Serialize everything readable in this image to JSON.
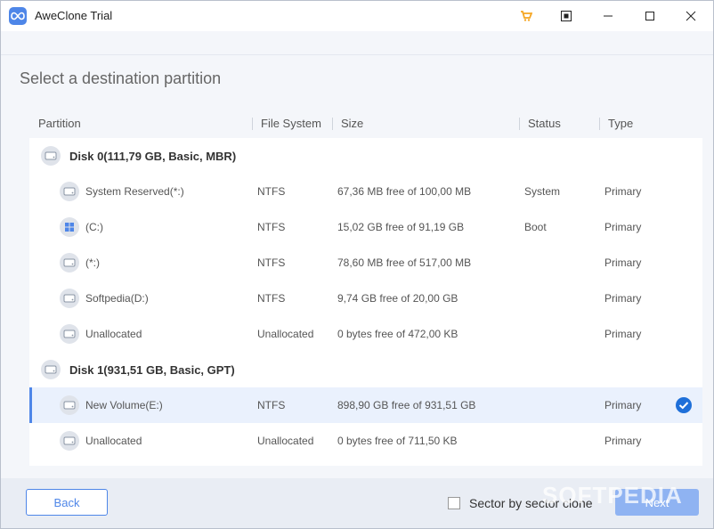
{
  "window": {
    "title": "AweClone Trial"
  },
  "heading": "Select a destination partition",
  "columns": {
    "partition": "Partition",
    "file_system": "File System",
    "size": "Size",
    "status": "Status",
    "type": "Type"
  },
  "rows": [
    {
      "kind": "disk",
      "name": "Disk 0(111,79 GB, Basic, MBR)"
    },
    {
      "kind": "partition",
      "icon": "drive-icon",
      "name": "System Reserved(*:)",
      "fs": "NTFS",
      "size": "67,36 MB free of 100,00 MB",
      "status": "System",
      "type": "Primary"
    },
    {
      "kind": "partition",
      "icon": "windows-drive-icon",
      "name": "(C:)",
      "fs": "NTFS",
      "size": "15,02 GB free of 91,19 GB",
      "status": "Boot",
      "type": "Primary"
    },
    {
      "kind": "partition",
      "icon": "drive-icon",
      "name": "(*:)",
      "fs": "NTFS",
      "size": "78,60 MB free of 517,00 MB",
      "status": "",
      "type": "Primary"
    },
    {
      "kind": "partition",
      "icon": "drive-icon",
      "name": "Softpedia(D:)",
      "fs": "NTFS",
      "size": "9,74 GB free of 20,00 GB",
      "status": "",
      "type": "Primary"
    },
    {
      "kind": "partition",
      "icon": "drive-icon",
      "name": "Unallocated",
      "fs": "Unallocated",
      "size": "0 bytes free of 472,00 KB",
      "status": "",
      "type": "Primary"
    },
    {
      "kind": "disk",
      "name": "Disk 1(931,51 GB, Basic, GPT)"
    },
    {
      "kind": "partition",
      "icon": "drive-icon",
      "name": "New Volume(E:)",
      "fs": "NTFS",
      "size": "898,90 GB free of 931,51 GB",
      "status": "",
      "type": "Primary",
      "selected": true
    },
    {
      "kind": "partition",
      "icon": "drive-icon",
      "name": "Unallocated",
      "fs": "Unallocated",
      "size": "0 bytes free of 711,50 KB",
      "status": "",
      "type": "Primary"
    }
  ],
  "footer": {
    "back_label": "Back",
    "sector_label": "Sector by sector clone",
    "sector_checked": false,
    "next_label": "Next"
  },
  "watermark": "SOFTPEDIA",
  "colors": {
    "accent": "#4e86e8",
    "next_disabled": "#8fb3f2",
    "selected_row": "#eaf1fd",
    "cart": "#f5a623"
  }
}
